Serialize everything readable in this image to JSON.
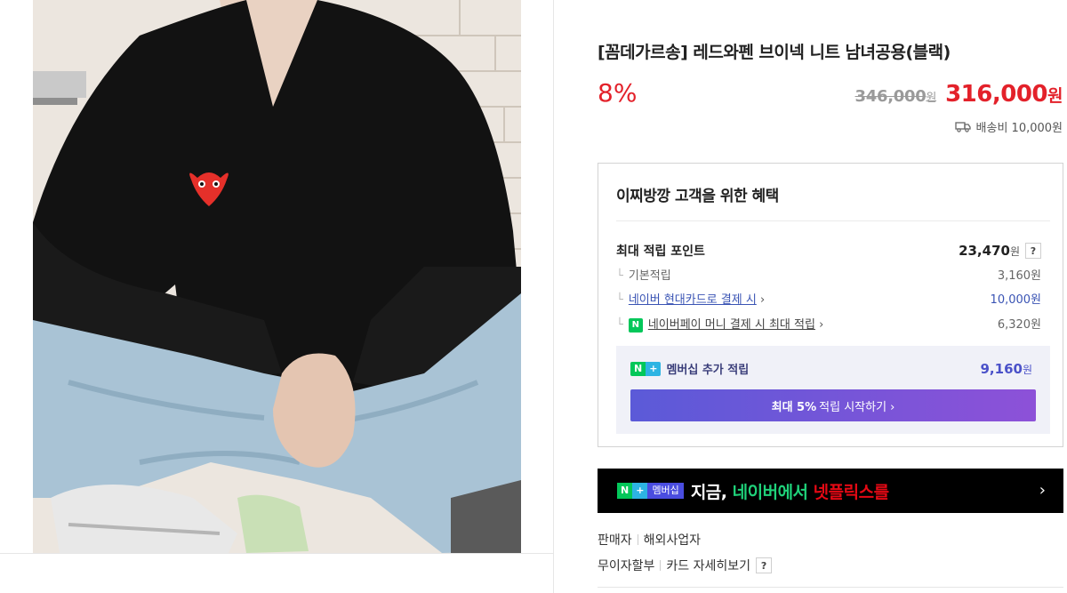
{
  "product": {
    "title": "[꼼데가르송] 레드와펜 브이넥 니트 남녀공용(블랙)",
    "discount": "8%",
    "original_price": "346,000",
    "original_unit": "원",
    "sale_price": "316,000",
    "sale_unit": "원",
    "shipping": "배송비 10,000원"
  },
  "benefit": {
    "title": "이찌방깡 고객을 위한 혜택",
    "max_points_label": "최대 적립 포인트",
    "max_points_value": "23,470",
    "max_points_unit": "원",
    "help_label": "?",
    "basic_label": "기본적립",
    "basic_value": "3,160원",
    "card_label": "네이버 현대카드로 결제 시",
    "card_value": "10,000원",
    "npay_icon": "N",
    "npay_label": "네이버페이 머니 결제 시 최대 적립",
    "npay_value": "6,320원",
    "chevron": "›",
    "membership": {
      "n": "N",
      "plus": "+",
      "label": "멤버십 추가 적립",
      "value": "9,160",
      "unit": "원",
      "button_bold": "최대 5%",
      "button_text": "적립 시작하기 ›"
    }
  },
  "banner": {
    "n": "N",
    "plus": "+",
    "membership": "멤버십",
    "t1": "지금,",
    "t2": "네이버에서",
    "t3": "넷플릭스를",
    "chevron": "›"
  },
  "seller": {
    "label": "판매자",
    "type": "해외사업자"
  },
  "installment": {
    "label": "무이자할부",
    "card_detail": "카드 자세히보기",
    "help": "?"
  },
  "colors": {
    "accent_red": "#e3212a",
    "naver_green": "#03c75a",
    "membership_purple": "#5b5ad8"
  }
}
